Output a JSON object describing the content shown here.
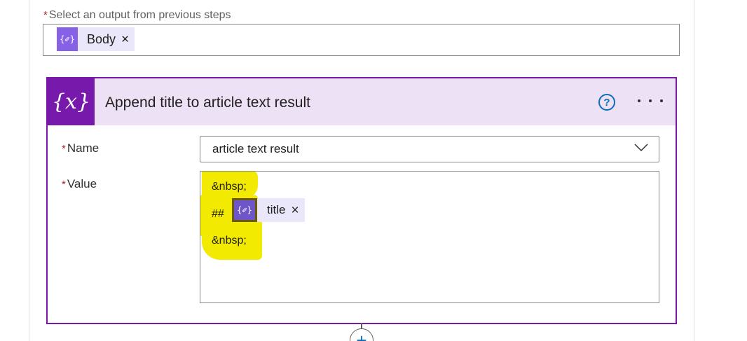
{
  "select_output": {
    "required_marker": "*",
    "label": "Select an output from previous steps",
    "token": {
      "icon": "expression-icon",
      "icon_glyph": "{✐}",
      "label": "Body",
      "remove_glyph": "×"
    }
  },
  "card": {
    "icon": "variable-icon",
    "icon_glyph": "{x}",
    "title": "Append title to article text result",
    "help_glyph": "?",
    "more_icon": "ellipsis-icon"
  },
  "fields": {
    "name": {
      "required_marker": "*",
      "label": "Name",
      "value": "article text result",
      "dropdown_icon": "chevron-down-icon"
    },
    "value": {
      "required_marker": "*",
      "label": "Value",
      "line1": "&nbsp;",
      "line2_prefix": "##",
      "token": {
        "icon": "expression-icon",
        "icon_glyph": "{✐}",
        "label": "title",
        "remove_glyph": "×"
      },
      "line3": "&nbsp;"
    }
  },
  "colors": {
    "accent_purple": "#7719aa",
    "header_tint": "#ede2f5",
    "token_icon": "#8661e8",
    "token_bg": "#ebe7fa",
    "highlighter": "#f2ea00",
    "required": "#a4262c",
    "link_blue": "#0f6cbd"
  },
  "add_step": {
    "glyph": "+"
  }
}
